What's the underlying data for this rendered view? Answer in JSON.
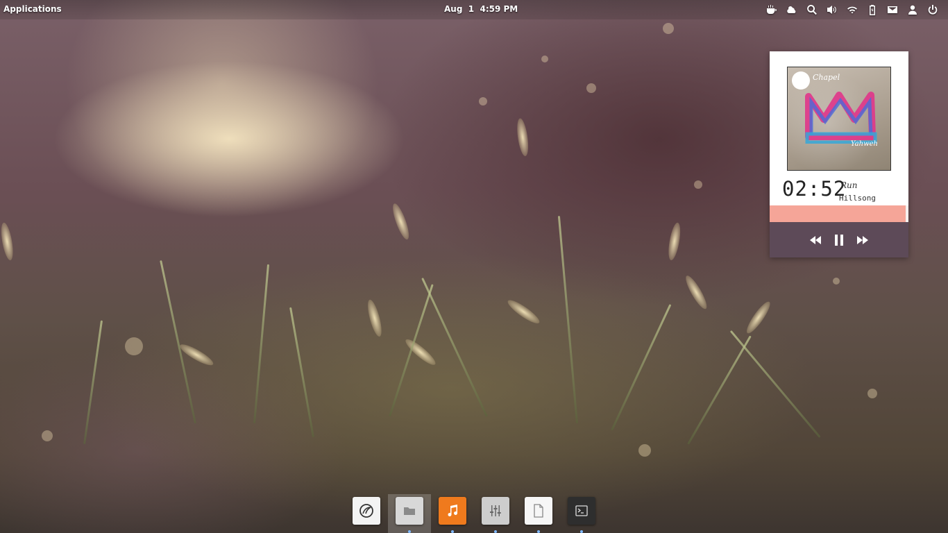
{
  "top_panel": {
    "applications_label": "Applications",
    "clock": "Aug  1  4:59 PM",
    "indicators": [
      {
        "name": "caffeine-icon"
      },
      {
        "name": "weather-icon"
      },
      {
        "name": "search-icon"
      },
      {
        "name": "volume-icon"
      },
      {
        "name": "wifi-icon"
      },
      {
        "name": "battery-icon"
      },
      {
        "name": "mail-icon"
      },
      {
        "name": "user-icon"
      },
      {
        "name": "power-icon"
      }
    ]
  },
  "music_widget": {
    "album_art": {
      "label_top": "Chapel",
      "label_bottom": "Yahweh"
    },
    "time": "02:52",
    "track_title": "Run",
    "artist": "Hillsong",
    "progress": 0.98,
    "controls": [
      "rewind-icon",
      "pause-icon",
      "fast-forward-icon"
    ]
  },
  "dock": {
    "items": [
      {
        "name": "browser-icon",
        "color": "#f0f0f0"
      },
      {
        "name": "files-icon",
        "color": "#d9d9d9"
      },
      {
        "name": "music-icon",
        "color": "#f07b1f"
      },
      {
        "name": "settings-icon",
        "color": "#cfcfcf"
      },
      {
        "name": "text-editor-icon",
        "color": "#f5f5f5"
      },
      {
        "name": "terminal-icon",
        "color": "#2f2f2f"
      }
    ]
  }
}
